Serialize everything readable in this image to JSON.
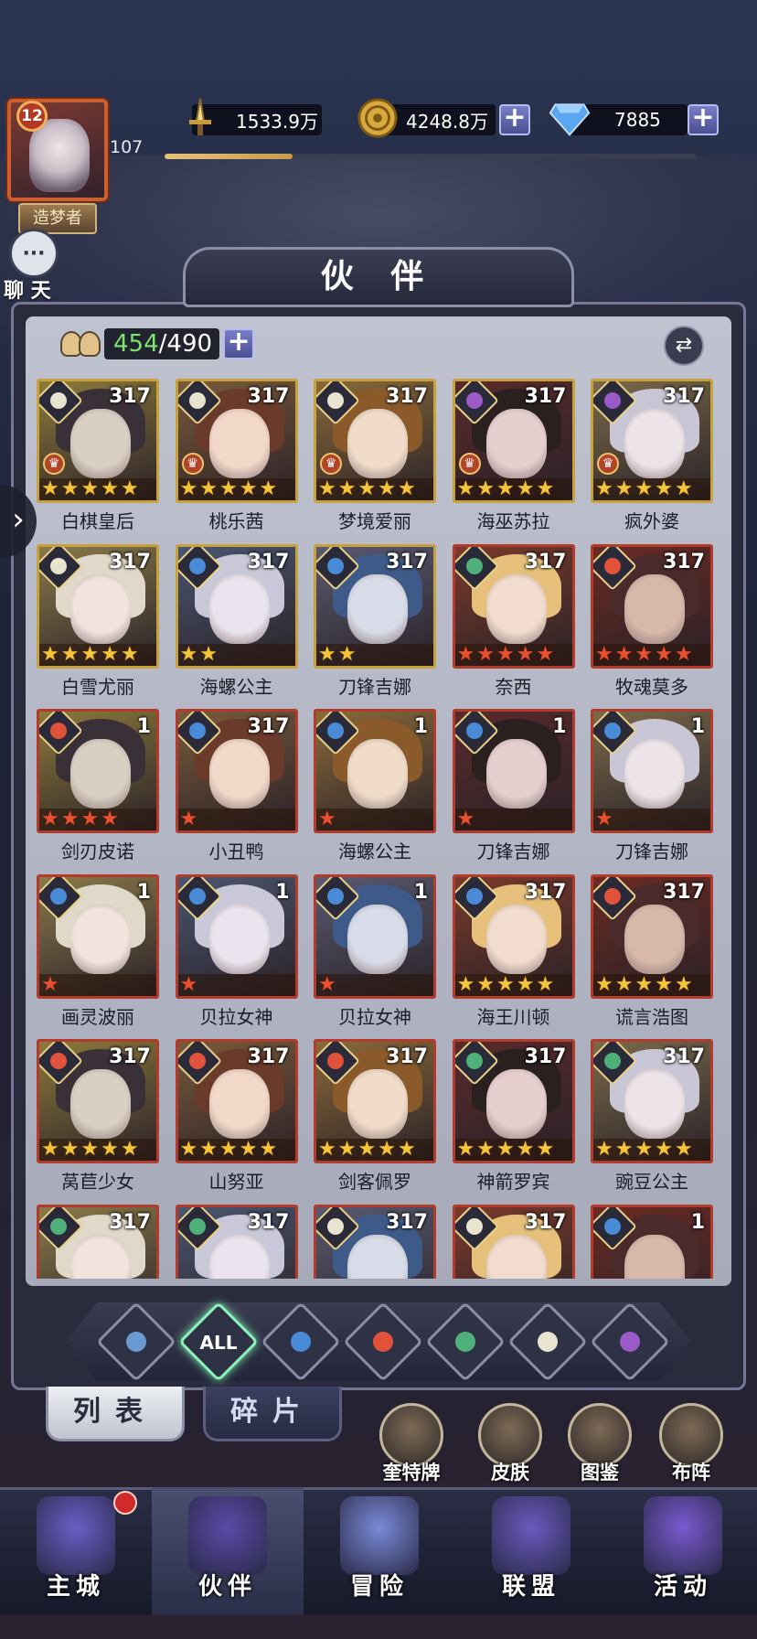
{
  "player": {
    "level": "12",
    "exp_value": "107",
    "exp_progress": 0.24,
    "title": "造梦者"
  },
  "resources": {
    "power": "1533.9万",
    "gold": "4248.8万",
    "diamond": "7885"
  },
  "chat": {
    "label": "聊 天"
  },
  "panel": {
    "title": "伙 伴",
    "count_current": "454",
    "count_max": "/490"
  },
  "partners": [
    {
      "name": "白棋皇后",
      "level": "317",
      "stars": 5,
      "star_color": "gold",
      "element": "light",
      "frame": "gold",
      "crown": true
    },
    {
      "name": "桃乐茜",
      "level": "317",
      "stars": 5,
      "star_color": "gold",
      "element": "light",
      "frame": "gold",
      "crown": true
    },
    {
      "name": "梦境爱丽",
      "level": "317",
      "stars": 5,
      "star_color": "gold",
      "element": "light",
      "frame": "gold",
      "crown": true
    },
    {
      "name": "海巫苏拉",
      "level": "317",
      "stars": 5,
      "star_color": "gold",
      "element": "dark",
      "frame": "gold",
      "crown": true
    },
    {
      "name": "疯外婆",
      "level": "317",
      "stars": 5,
      "star_color": "gold",
      "element": "dark",
      "frame": "gold",
      "crown": true
    },
    {
      "name": "白雪尤丽",
      "level": "317",
      "stars": 5,
      "star_color": "gold",
      "element": "light",
      "frame": "gold",
      "crown": false
    },
    {
      "name": "海螺公主",
      "level": "317",
      "stars": 2,
      "star_color": "gold",
      "element": "water",
      "frame": "gold",
      "crown": false
    },
    {
      "name": "刀锋吉娜",
      "level": "317",
      "stars": 2,
      "star_color": "gold",
      "element": "water",
      "frame": "gold",
      "crown": false
    },
    {
      "name": "奈西",
      "level": "317",
      "stars": 5,
      "star_color": "red",
      "element": "wind",
      "frame": "red",
      "crown": false
    },
    {
      "name": "牧魂莫多",
      "level": "317",
      "stars": 5,
      "star_color": "red",
      "element": "fire",
      "frame": "red",
      "crown": false
    },
    {
      "name": "剑刃皮诺",
      "level": "1",
      "stars": 4,
      "star_color": "red",
      "element": "fire",
      "frame": "red",
      "crown": false
    },
    {
      "name": "小丑鸭",
      "level": "317",
      "stars": 1,
      "star_color": "red",
      "element": "water",
      "frame": "red",
      "crown": false
    },
    {
      "name": "海螺公主",
      "level": "1",
      "stars": 1,
      "star_color": "red",
      "element": "water",
      "frame": "red",
      "crown": false
    },
    {
      "name": "刀锋吉娜",
      "level": "1",
      "stars": 1,
      "star_color": "red",
      "element": "water",
      "frame": "red",
      "crown": false
    },
    {
      "name": "刀锋吉娜",
      "level": "1",
      "stars": 1,
      "star_color": "red",
      "element": "water",
      "frame": "red",
      "crown": false
    },
    {
      "name": "画灵波丽",
      "level": "1",
      "stars": 1,
      "star_color": "red",
      "element": "water",
      "frame": "red",
      "crown": false
    },
    {
      "name": "贝拉女神",
      "level": "1",
      "stars": 1,
      "star_color": "red",
      "element": "water",
      "frame": "red",
      "crown": false
    },
    {
      "name": "贝拉女神",
      "level": "1",
      "stars": 1,
      "star_color": "red",
      "element": "water",
      "frame": "red",
      "crown": false
    },
    {
      "name": "海王川顿",
      "level": "317",
      "stars": 5,
      "star_color": "gold",
      "element": "water",
      "frame": "red",
      "crown": false
    },
    {
      "name": "谎言浩图",
      "level": "317",
      "stars": 5,
      "star_color": "gold",
      "element": "fire",
      "frame": "red",
      "crown": false
    },
    {
      "name": "莴苣少女",
      "level": "317",
      "stars": 5,
      "star_color": "gold",
      "element": "fire",
      "frame": "red",
      "crown": false
    },
    {
      "name": "山努亚",
      "level": "317",
      "stars": 5,
      "star_color": "gold",
      "element": "fire",
      "frame": "red",
      "crown": false
    },
    {
      "name": "剑客佩罗",
      "level": "317",
      "stars": 5,
      "star_color": "gold",
      "element": "fire",
      "frame": "red",
      "crown": false
    },
    {
      "name": "神箭罗宾",
      "level": "317",
      "stars": 5,
      "star_color": "gold",
      "element": "wind",
      "frame": "red",
      "crown": false
    },
    {
      "name": "豌豆公主",
      "level": "317",
      "stars": 5,
      "star_color": "gold",
      "element": "wind",
      "frame": "red",
      "crown": false
    },
    {
      "name": "",
      "level": "317",
      "stars": 0,
      "star_color": "gold",
      "element": "wind",
      "frame": "red",
      "crown": false
    },
    {
      "name": "",
      "level": "317",
      "stars": 0,
      "star_color": "gold",
      "element": "wind",
      "frame": "red",
      "crown": false
    },
    {
      "name": "",
      "level": "317",
      "stars": 0,
      "star_color": "gold",
      "element": "light",
      "frame": "red",
      "crown": false
    },
    {
      "name": "",
      "level": "317",
      "stars": 0,
      "star_color": "gold",
      "element": "light",
      "frame": "red",
      "crown": false
    },
    {
      "name": "",
      "level": "1",
      "stars": 0,
      "star_color": "gold",
      "element": "water",
      "frame": "red",
      "crown": false
    }
  ],
  "element_colors": {
    "light": "#e9e4d0",
    "dark": "#9a5bc8",
    "water": "#4a8bd8",
    "fire": "#e0533a",
    "wind": "#4fb07a"
  },
  "filters": {
    "all_label": "ALL",
    "items": [
      "water-alt",
      "all",
      "water",
      "fire",
      "wind",
      "light",
      "dark"
    ],
    "active": "all"
  },
  "tabs": {
    "list": "列表",
    "fragments": "碎片"
  },
  "side_buttons": [
    {
      "label": "奎特牌",
      "icon": "cards-icon"
    },
    {
      "label": "皮肤",
      "icon": "skin-icon"
    },
    {
      "label": "图鉴",
      "icon": "codex-icon"
    },
    {
      "label": "布阵",
      "icon": "formation-icon"
    }
  ],
  "nav": [
    {
      "label": "主城",
      "icon": "castle-icon"
    },
    {
      "label": "伙伴",
      "icon": "witch-hat-icon"
    },
    {
      "label": "冒险",
      "icon": "compass-icon"
    },
    {
      "label": "联盟",
      "icon": "shield-icon"
    },
    {
      "label": "活动",
      "icon": "cards-icon"
    }
  ]
}
